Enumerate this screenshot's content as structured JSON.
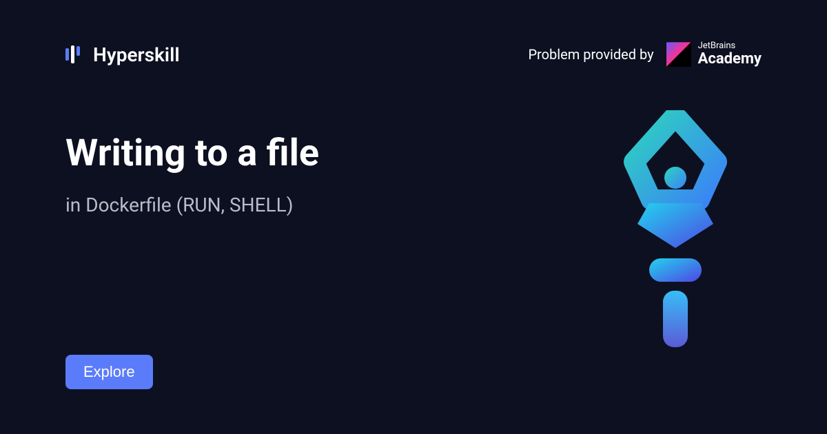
{
  "header": {
    "brand": "Hyperskill",
    "provider_label": "Problem provided by",
    "provider_brand_line1": "JetBrains",
    "provider_brand_line2": "Academy"
  },
  "main": {
    "title": "Writing to a file",
    "subtitle": "in Dockerfile (RUN, SHELL)"
  },
  "cta": {
    "explore_label": "Explore"
  }
}
